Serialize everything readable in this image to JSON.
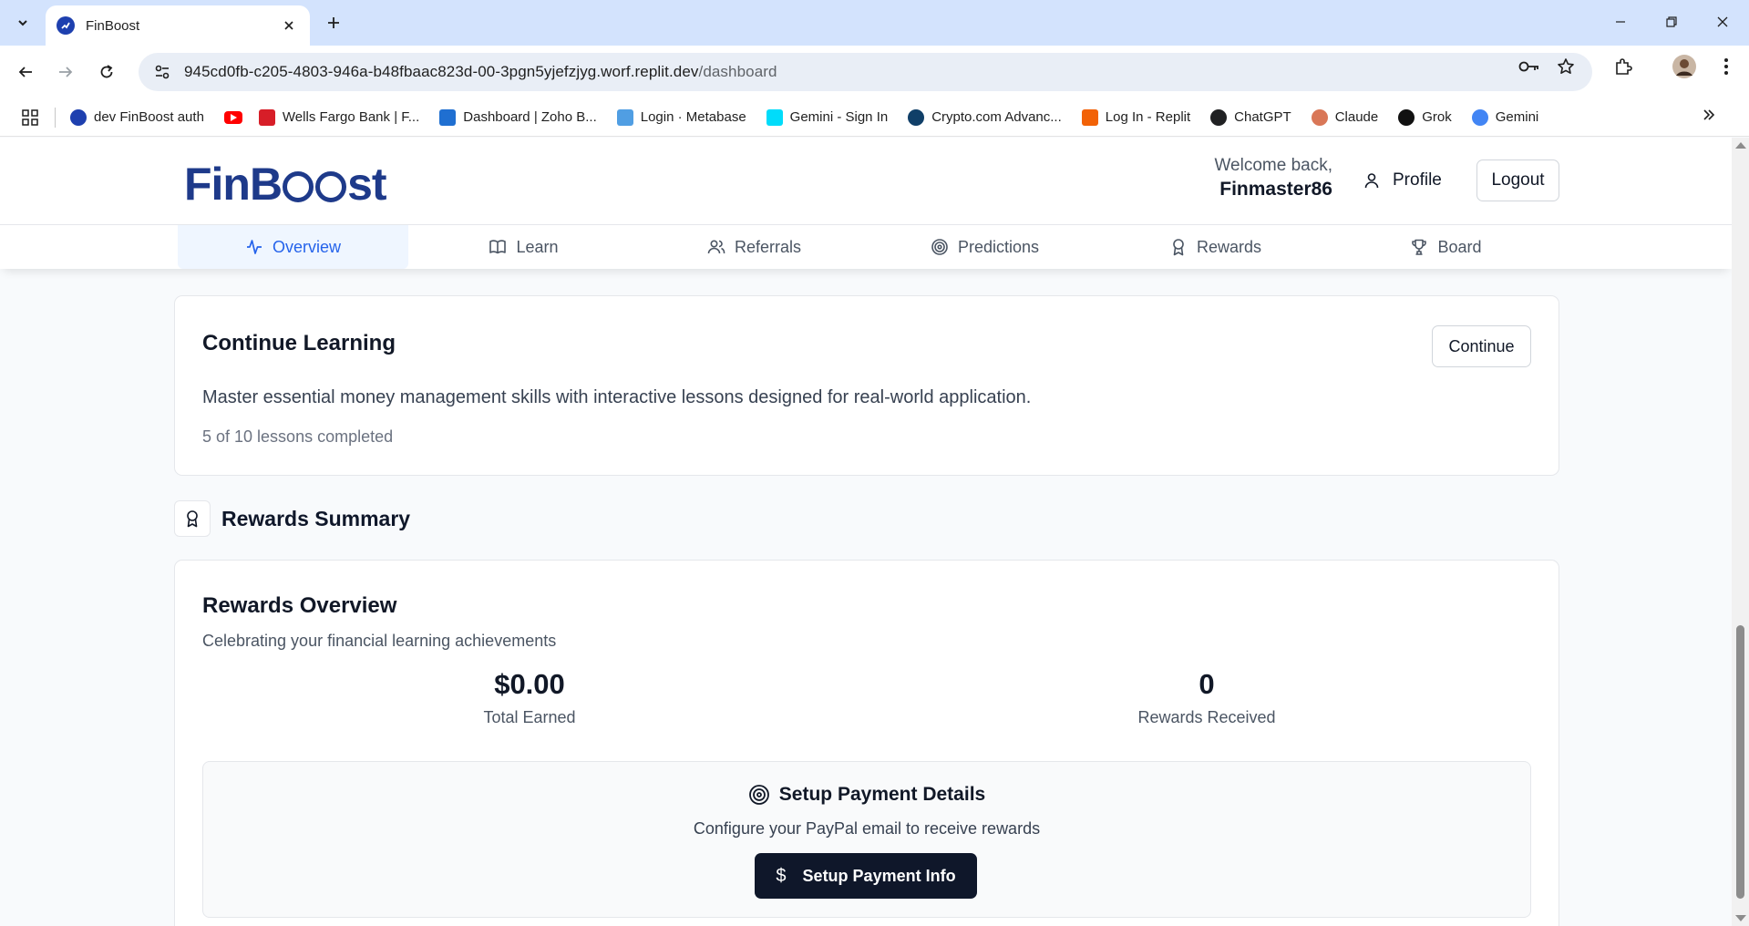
{
  "browser": {
    "tab_title": "FinBoost",
    "url_host": "945cd0fb-c205-4803-946a-b48fbaac823d-00-3pgn5yjefzjyg.worf.replit.dev",
    "url_path": "/dashboard",
    "bookmarks": [
      {
        "label": "dev FinBoost auth",
        "icon": "finboost-icon",
        "color": "#1e40af"
      },
      {
        "label": "",
        "icon": "youtube-icon",
        "color": "#ff0000"
      },
      {
        "label": "Wells Fargo Bank | F...",
        "icon": "wells-fargo-icon",
        "color": "#d71e28"
      },
      {
        "label": "Dashboard | Zoho B...",
        "icon": "zoho-icon",
        "color": "#1f6fd1"
      },
      {
        "label": "Login · Metabase",
        "icon": "metabase-icon",
        "color": "#509ee3"
      },
      {
        "label": "Gemini - Sign In",
        "icon": "gemini-exchange-icon",
        "color": "#00dcfa"
      },
      {
        "label": "Crypto.com Advanc...",
        "icon": "crypto-com-icon",
        "color": "#103f68"
      },
      {
        "label": "Log In - Replit",
        "icon": "replit-icon",
        "color": "#f26207"
      },
      {
        "label": "ChatGPT",
        "icon": "chatgpt-icon",
        "color": "#202123"
      },
      {
        "label": "Claude",
        "icon": "claude-icon",
        "color": "#d97757"
      },
      {
        "label": "Grok",
        "icon": "grok-icon",
        "color": "#111111"
      },
      {
        "label": "Gemini",
        "icon": "gemini-icon",
        "color": "#4285f4"
      }
    ]
  },
  "header": {
    "logo_text_before": "FinB",
    "logo_text_after": "st",
    "welcome_line": "Welcome back,",
    "username": "Finmaster86",
    "profile_label": "Profile",
    "logout_label": "Logout"
  },
  "nav": {
    "tabs": [
      {
        "label": "Overview",
        "icon": "activity-icon",
        "active": true
      },
      {
        "label": "Learn",
        "icon": "book-icon",
        "active": false
      },
      {
        "label": "Referrals",
        "icon": "users-icon",
        "active": false
      },
      {
        "label": "Predictions",
        "icon": "target-icon",
        "active": false
      },
      {
        "label": "Rewards",
        "icon": "award-icon",
        "active": false
      },
      {
        "label": "Board",
        "icon": "trophy-icon",
        "active": false
      }
    ]
  },
  "continue_learning": {
    "title": "Continue Learning",
    "button_label": "Continue",
    "description": "Master essential money management skills with interactive lessons designed for real-world application.",
    "progress_text": "5 of 10 lessons completed"
  },
  "rewards_summary": {
    "heading": "Rewards Summary",
    "overview_title": "Rewards Overview",
    "overview_subtitle": "Celebrating your financial learning achievements",
    "total_earned_value": "$0.00",
    "total_earned_label": "Total Earned",
    "rewards_received_value": "0",
    "rewards_received_label": "Rewards Received",
    "payment": {
      "title": "Setup Payment Details",
      "description": "Configure your PayPal email to receive rewards",
      "button_label": "Setup Payment Info",
      "button_icon": "$"
    }
  },
  "colors": {
    "brand": "#1e3a8a",
    "accent": "#2563eb",
    "dark_button": "#0f172a"
  }
}
